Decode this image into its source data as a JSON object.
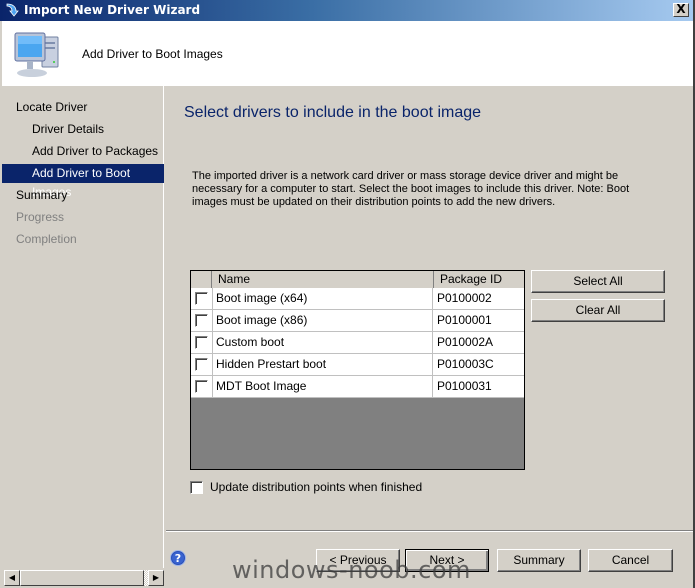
{
  "window": {
    "title": "Import New Driver Wizard",
    "close_label": "X"
  },
  "header": {
    "title": "Add Driver to Boot Images",
    "icon": "computer-icon"
  },
  "sidebar": {
    "items": [
      {
        "label": "Locate Driver",
        "level": 0,
        "state": "normal"
      },
      {
        "label": "Driver Details",
        "level": 1,
        "state": "normal"
      },
      {
        "label": "Add Driver to Packages",
        "level": 1,
        "state": "normal"
      },
      {
        "label": "Add Driver to Boot Images",
        "level": 1,
        "state": "active"
      },
      {
        "label": "Summary",
        "level": 0,
        "state": "normal"
      },
      {
        "label": "Progress",
        "level": 0,
        "state": "disabled"
      },
      {
        "label": "Completion",
        "level": 0,
        "state": "disabled"
      }
    ]
  },
  "main": {
    "heading": "Select drivers to include in the boot image",
    "description": "The imported driver is a network card driver or mass storage device driver and might be necessary for a computer to start. Select the boot images to include this driver.  Note: Boot images must be updated on their distribution points to add the new drivers.",
    "table": {
      "columns": [
        "Name",
        "Package ID"
      ],
      "rows": [
        {
          "name": "Boot image (x64)",
          "package_id": "P0100002",
          "checked": false
        },
        {
          "name": "Boot image (x86)",
          "package_id": "P0100001",
          "checked": false
        },
        {
          "name": "Custom boot",
          "package_id": "P010002A",
          "checked": false
        },
        {
          "name": "Hidden Prestart boot",
          "package_id": "P010003C",
          "checked": false
        },
        {
          "name": "MDT Boot Image",
          "package_id": "P0100031",
          "checked": false
        }
      ]
    },
    "select_all_label": "Select All",
    "clear_all_label": "Clear All",
    "update_dp_label": "Update distribution points when finished",
    "update_dp_checked": false
  },
  "footer": {
    "previous_label": "< Previous",
    "next_label": "Next >",
    "summary_label": "Summary",
    "cancel_label": "Cancel",
    "help_icon": "help-icon"
  },
  "watermark": "windows-noob.com",
  "colors": {
    "title_bar_start": "#0a246a",
    "title_bar_end": "#a6caf0",
    "heading": "#0a246a",
    "selection": "#0a246a",
    "dialog_bg": "#d4d0c8"
  }
}
